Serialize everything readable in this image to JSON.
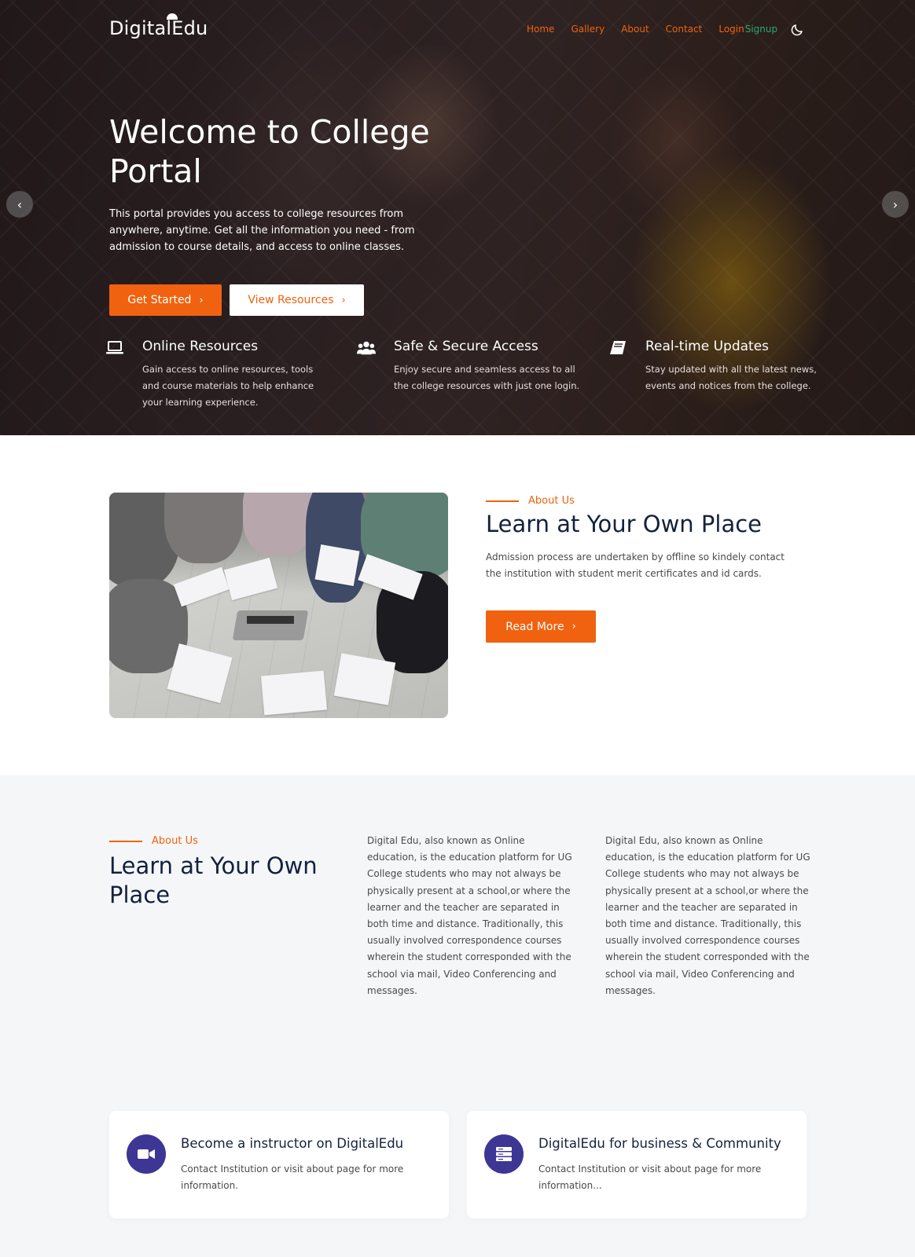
{
  "header": {
    "logo": "DigitalEdu",
    "nav": [
      "Home",
      "Gallery",
      "About",
      "Contact",
      "Login"
    ],
    "signup": "Signup"
  },
  "hero": {
    "title": "Welcome to College Portal",
    "text": "This portal provides you access to college resources from anywhere, anytime. Get all the information you need - from admission to course details, and access to online classes.",
    "primary_button": "Get Started",
    "secondary_button": "View Resources",
    "features": [
      {
        "icon": "laptop-icon",
        "title": "Online Resources",
        "text": "Gain access to online resources, tools and course materials to help enhance your learning experience."
      },
      {
        "icon": "users-icon",
        "title": "Safe & Secure Access",
        "text": "Enjoy secure and seamless access to all the college resources with just one login."
      },
      {
        "icon": "book-icon",
        "title": "Real-time Updates",
        "text": "Stay updated with all the latest news, events and notices from the college."
      }
    ]
  },
  "about": {
    "eyebrow": "About Us",
    "title": "Learn at Your Own Place",
    "text": "Admission process are undertaken by offline so kindely contact the institution with student merit certificates and id cards.",
    "button": "Read More"
  },
  "about2": {
    "eyebrow": "About Us",
    "title": "Learn at Your Own Place",
    "columns": [
      "Digital Edu, also known as Online education, is the education platform for UG College students who may not always be physically present at a school,or where the learner and the teacher are separated in both time and distance. Traditionally, this usually involved correspondence courses wherein the student corresponded with the school via mail, Video Conferencing and messages.",
      "Digital Edu, also known as Online education, is the education platform for UG College students who may not always be physically present at a school,or where the learner and the teacher are separated in both time and distance. Traditionally, this usually involved correspondence courses wherein the student corresponded with the school via mail, Video Conferencing and messages."
    ]
  },
  "cards": [
    {
      "icon": "video-camera-icon",
      "title": "Become a instructor on DigitalEdu",
      "text": "Contact Institution or visit about page for more information."
    },
    {
      "icon": "server-icon",
      "title": "DigitalEdu for business & Community",
      "text": "Contact Institution or visit about page for more information..."
    }
  ],
  "colors": {
    "accent": "#f0620f",
    "signup": "#2aa774",
    "card_icon_bg": "#3d3694",
    "heading": "#14213d"
  }
}
